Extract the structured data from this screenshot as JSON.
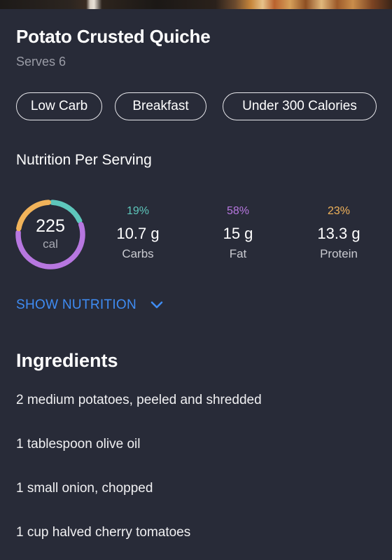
{
  "recipe": {
    "title": "Potato Crusted Quiche",
    "serves": "Serves 6",
    "tags": [
      "Low Carb",
      "Breakfast",
      "Under 300 Calories"
    ]
  },
  "nutrition": {
    "section_title": "Nutrition Per Serving",
    "calories": "225",
    "calories_unit": "cal",
    "macros": [
      {
        "percent": "19%",
        "amount": "10.7 g",
        "label": "Carbs",
        "color": "#5ec7bc"
      },
      {
        "percent": "58%",
        "amount": "15 g",
        "label": "Fat",
        "color": "#b777e0"
      },
      {
        "percent": "23%",
        "amount": "13.3 g",
        "label": "Protein",
        "color": "#f1b35a"
      }
    ],
    "show_label": "SHOW NUTRITION",
    "show_icon": "chevron-down-icon"
  },
  "ingredients": {
    "title": "Ingredients",
    "items": [
      "2 medium potatoes, peeled and shredded",
      "1 tablespoon olive oil",
      "1 small onion, chopped",
      "1 cup halved cherry tomatoes"
    ]
  },
  "colors": {
    "background": "#282b38",
    "accent": "#3f8cf3"
  }
}
